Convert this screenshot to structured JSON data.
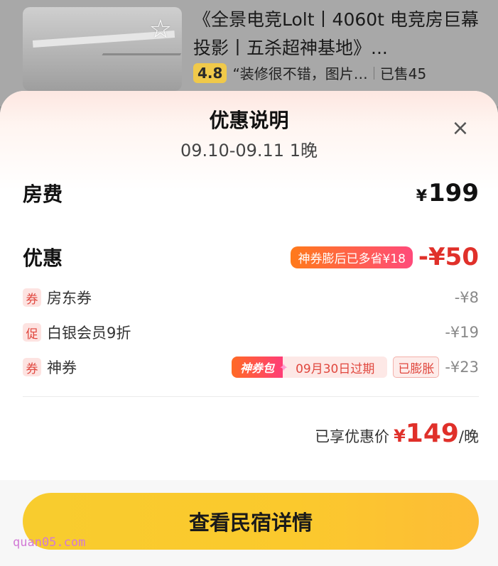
{
  "listing": {
    "title": "《全景电竞Lolt丨4060t  电竞房巨幕投影丨五杀超神基地》...",
    "rating": "4.8",
    "review": "“装修很不错，图片…",
    "sold": "已售45"
  },
  "sheet": {
    "title": "优惠说明",
    "dates": "09.10-09.11 1晚",
    "close": "×"
  },
  "room_fee": {
    "label": "房费",
    "currency": "¥",
    "amount": "199"
  },
  "discount": {
    "label": "优惠",
    "saved_tag": "神券膨后已多省¥18",
    "total": "-¥50",
    "items": [
      {
        "badge": "券",
        "label": "房东券",
        "amount": "-¥8"
      },
      {
        "badge": "促",
        "label": "白银会员9折",
        "amount": "-¥19"
      },
      {
        "badge": "券",
        "label": "神券",
        "amount": "-¥23",
        "coupon_brand": "神券包",
        "expire": "09月30日过期",
        "inflated": "已膨胀"
      }
    ]
  },
  "final": {
    "label": "已享优惠价",
    "currency": "¥",
    "amount": "149",
    "unit": "/晚"
  },
  "cta": {
    "label": "查看民宿详情"
  },
  "watermark": "quan05.com",
  "colors": {
    "accent_red": "#e0302a",
    "cta_yellow": "#fbc92d",
    "badge_bg": "#fde3e1"
  }
}
